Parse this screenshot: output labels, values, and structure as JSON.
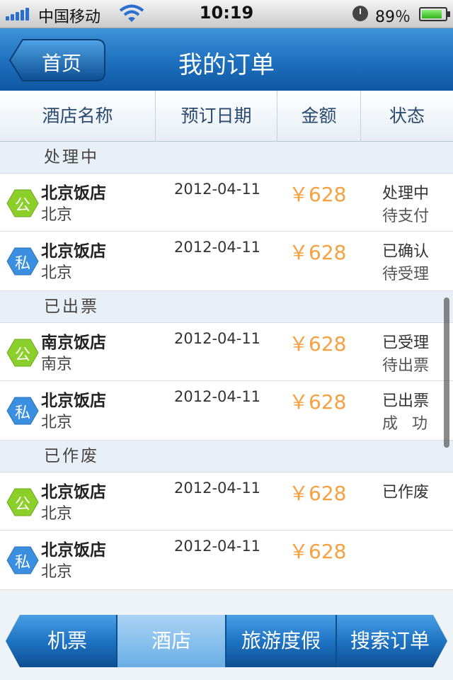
{
  "status_bar": {
    "carrier": "中国移动",
    "time": "10:19",
    "battery": "89％"
  },
  "nav": {
    "back_label": "首页",
    "title": "我的订单"
  },
  "columns": [
    "酒店名称",
    "预订日期",
    "金额",
    "状态"
  ],
  "sections": [
    {
      "title": "处理中",
      "rows": [
        {
          "badge": "公",
          "badge_type": "public",
          "name": "北京饭店",
          "city": "北京",
          "date": "2012-04-11",
          "price": "￥628",
          "status1": "处理中",
          "status2": "待支付"
        },
        {
          "badge": "私",
          "badge_type": "private",
          "name": "北京饭店",
          "city": "北京",
          "date": "2012-04-11",
          "price": "￥628",
          "status1": "已确认",
          "status2": "待受理"
        }
      ]
    },
    {
      "title": "已出票",
      "rows": [
        {
          "badge": "公",
          "badge_type": "public",
          "name": "南京饭店",
          "city": "南京",
          "date": "2012-04-11",
          "price": "￥628",
          "status1": "已受理",
          "status2": "待出票"
        },
        {
          "badge": "私",
          "badge_type": "private",
          "name": "北京饭店",
          "city": "北京",
          "date": "2012-04-11",
          "price": "￥628",
          "status1": "已出票",
          "status2": "成功"
        }
      ]
    },
    {
      "title": "已作废",
      "rows": [
        {
          "badge": "公",
          "badge_type": "public",
          "name": "北京饭店",
          "city": "北京",
          "date": "2012-04-11",
          "price": "￥628",
          "status1": "已作废",
          "status2": ""
        },
        {
          "badge": "私",
          "badge_type": "private",
          "name": "北京饭店",
          "city": "北京",
          "date": "2012-04-11",
          "price": "￥628",
          "status1": "",
          "status2": ""
        }
      ]
    }
  ],
  "tabs": [
    {
      "label": "机票",
      "active": false
    },
    {
      "label": "酒店",
      "active": true
    },
    {
      "label": "旅游度假",
      "active": false
    },
    {
      "label": "搜索订单",
      "active": false
    }
  ],
  "colors": {
    "nav_blue": "#1d6fbd",
    "price_orange": "#f7a040",
    "public_badge_green": "#8ccf2a",
    "private_badge_blue": "#3a8fe0"
  }
}
